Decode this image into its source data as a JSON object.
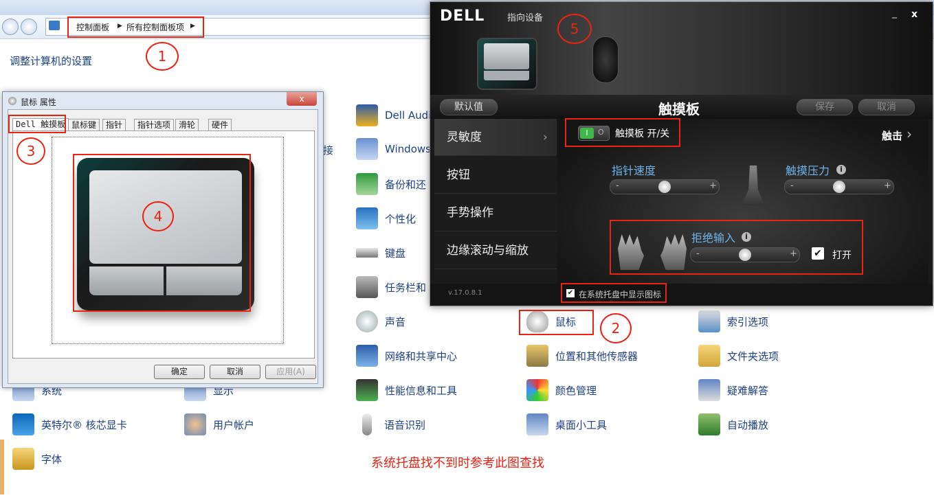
{
  "control_panel": {
    "breadcrumb": [
      "控制面板",
      "所有控制面板项"
    ],
    "heading": "调整计算机的设置",
    "items": [
      {
        "label": "Dell Audi",
        "icon": "audio-icon"
      },
      {
        "label": "Windows",
        "icon": "windows-icon"
      },
      {
        "label": "备份和还",
        "icon": "backup-icon"
      },
      {
        "label": "个性化",
        "icon": "personalize-icon"
      },
      {
        "label": "键盘",
        "icon": "keyboard-icon"
      },
      {
        "label": "任务栏和",
        "icon": "taskbar-icon"
      },
      {
        "label": "声音",
        "icon": "sound-icon"
      },
      {
        "label": "鼠标",
        "icon": "mouse-icon"
      },
      {
        "label": "索引选项",
        "icon": "index-icon"
      },
      {
        "label": "网络和共享中心",
        "icon": "network-icon"
      },
      {
        "label": "位置和其他传感器",
        "icon": "sensor-icon"
      },
      {
        "label": "文件夹选项",
        "icon": "folder-icon"
      },
      {
        "label": "系统",
        "icon": "system-icon"
      },
      {
        "label": "显示",
        "icon": "display-icon"
      },
      {
        "label": "性能信息和工具",
        "icon": "performance-icon"
      },
      {
        "label": "颜色管理",
        "icon": "color-icon"
      },
      {
        "label": "疑难解答",
        "icon": "troubleshoot-icon"
      },
      {
        "label": "英特尔® 核芯显卡",
        "icon": "intel-icon"
      },
      {
        "label": "用户帐户",
        "icon": "users-icon"
      },
      {
        "label": "语音识别",
        "icon": "mic-icon"
      },
      {
        "label": "桌面小工具",
        "icon": "gadget-icon"
      },
      {
        "label": "自动播放",
        "icon": "autoplay-icon"
      },
      {
        "label": "字体",
        "icon": "font-icon"
      },
      {
        "label": "接",
        "icon": ""
      }
    ]
  },
  "mouse_dialog": {
    "title": "鼠标 属性",
    "close": "x",
    "tabs": [
      "Dell 触摸板",
      "鼠标键",
      "指针",
      "指针选项",
      "滑轮",
      "硬件"
    ],
    "buttons": {
      "ok": "确定",
      "cancel": "取消",
      "apply": "应用(A)"
    }
  },
  "dell_window": {
    "logo": "DELL",
    "title": "指向设备",
    "minimize": "_",
    "close": "x",
    "defaults_button": "默认值",
    "panel_title": "触摸板",
    "save_button": "保存",
    "cancel_button": "取消",
    "sidebar": [
      "灵敏度",
      "按钮",
      "手势操作",
      "边缘滚动与缩放"
    ],
    "touchpad_toggle_label": "触摸板 开/关",
    "toggle_on": "I",
    "toggle_off": "O",
    "tap_link": "触击",
    "pointer_speed": {
      "label": "指针速度",
      "level": 0.5
    },
    "touch_pressure": {
      "label": "触摸压力",
      "level": 0.5
    },
    "palm_rejection": {
      "label": "拒绝输入",
      "level": 0.5
    },
    "palm_open_label": "打开",
    "minus": "-",
    "plus": "+",
    "info": "i",
    "version": "v.17.0.8.1",
    "tray_label": "在系统托盘中显示图标",
    "check": "✔"
  },
  "annotations": {
    "n1": "1",
    "n2": "2",
    "n3": "3",
    "n4": "4",
    "n5": "5"
  },
  "note": "系统托盘找不到时参考此图查找",
  "colors": {
    "annotation_red": "#e21",
    "link_blue": "#1e3f8a",
    "dell_accent": "#6fb4ea"
  }
}
